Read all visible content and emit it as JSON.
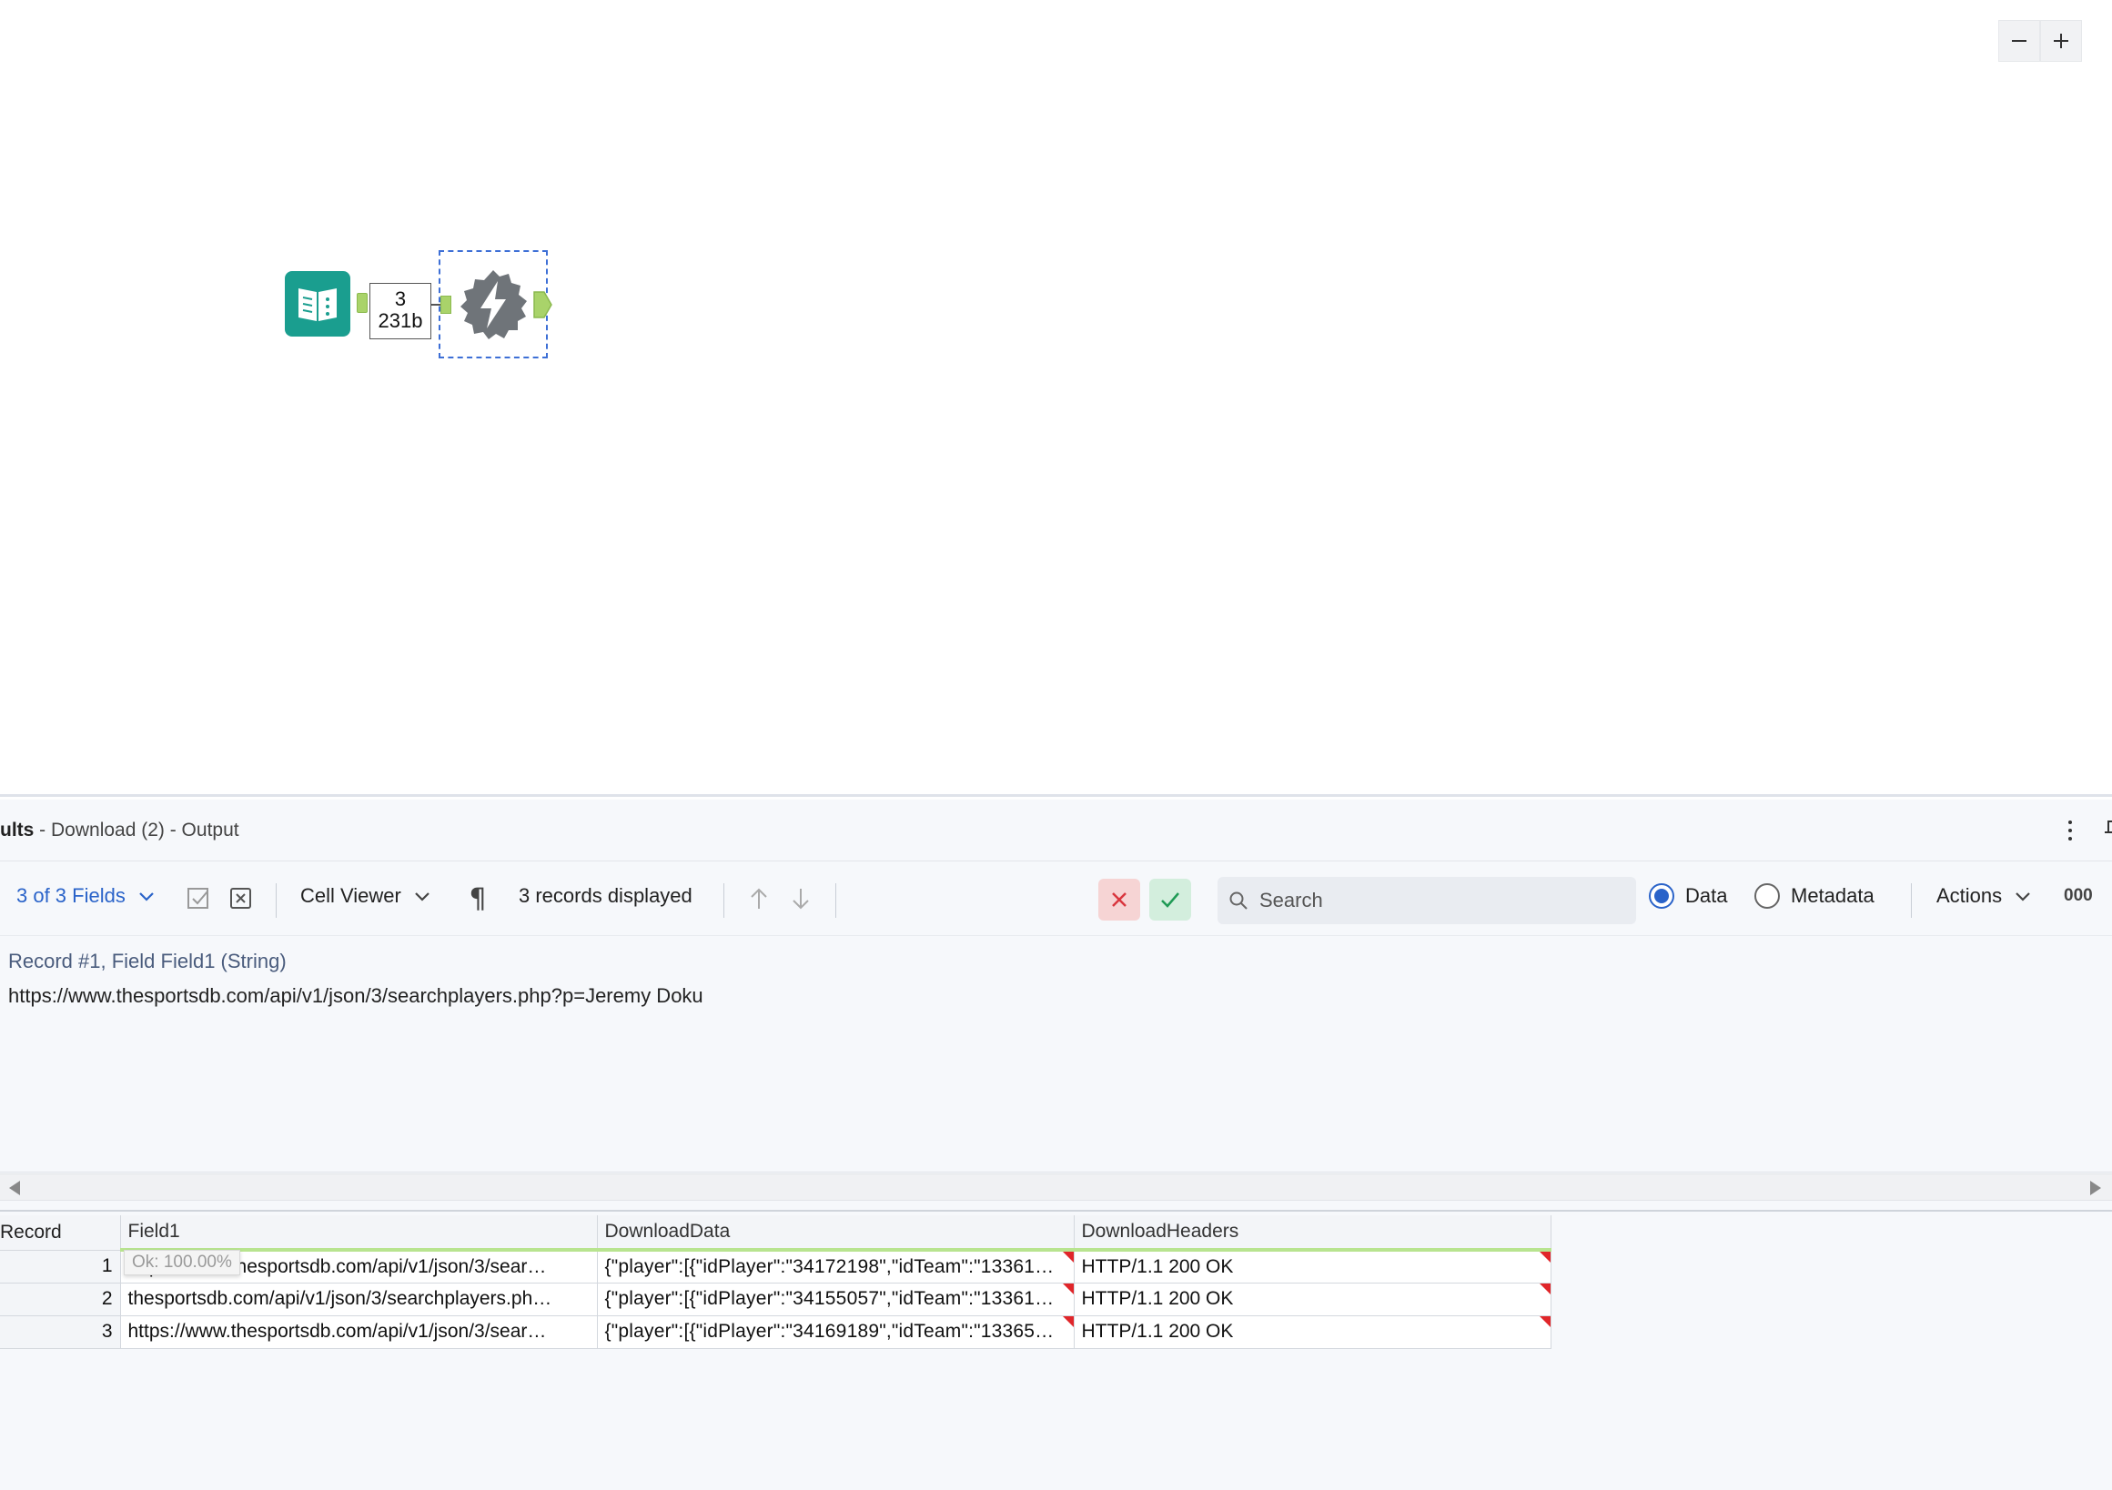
{
  "canvas": {
    "zoom_out_label": "−",
    "zoom_in_label": "+",
    "record_badge": {
      "count": "3",
      "size": "231b"
    }
  },
  "results": {
    "title_bold": "ults",
    "title_rest": " - Download (2) - Output"
  },
  "toolbar": {
    "fields_label": "3 of 3 Fields",
    "cell_viewer_label": "Cell Viewer",
    "records_displayed": "3 records displayed",
    "search_placeholder": "Search",
    "radio_data": "Data",
    "radio_metadata": "Metadata",
    "actions_label": "Actions",
    "number_format": "000"
  },
  "cell_viewer": {
    "label": "Record #1, Field Field1 (String)",
    "value": "https://www.thesportsdb.com/api/v1/json/3/searchplayers.php?p=Jeremy Doku"
  },
  "grid": {
    "headers": {
      "record": "Record",
      "field1": "Field1",
      "download_data": "DownloadData",
      "download_headers": "DownloadHeaders"
    },
    "rows": [
      {
        "record": "1",
        "field1": "https://www.thesportsdb.com/api/v1/json/3/sear…",
        "download_data": "{\"player\":[{\"idPlayer\":\"34172198\",\"idTeam\":\"13361…",
        "download_headers": "HTTP/1.1 200 OK"
      },
      {
        "record": "2",
        "field1": "thesportsdb.com/api/v1/json/3/searchplayers.ph…",
        "download_data": "{\"player\":[{\"idPlayer\":\"34155057\",\"idTeam\":\"13361…",
        "download_headers": "HTTP/1.1 200 OK"
      },
      {
        "record": "3",
        "field1": "https://www.thesportsdb.com/api/v1/json/3/sear…",
        "download_data": "{\"player\":[{\"idPlayer\":\"34169189\",\"idTeam\":\"13365…",
        "download_headers": "HTTP/1.1 200 OK"
      }
    ],
    "tooltip": "Ok: 100.00%"
  },
  "colors": {
    "input_tool": "#1a9e8f",
    "download_tool": "#6f7479",
    "anchor": "#a9d36a",
    "accent": "#2a63c9",
    "column_ok_bar": "#b8e48f",
    "truncation_flag": "#e0262a"
  }
}
